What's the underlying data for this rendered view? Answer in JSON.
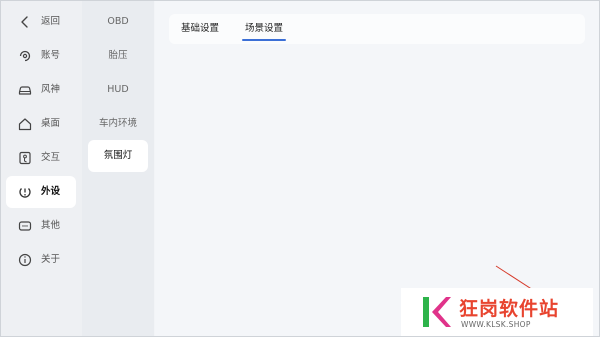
{
  "sidebar": {
    "items": [
      {
        "label": "返回",
        "icon": "back-chevron-icon"
      },
      {
        "label": "账号",
        "icon": "account-icon"
      },
      {
        "label": "风神",
        "icon": "car-icon"
      },
      {
        "label": "桌面",
        "icon": "home-icon"
      },
      {
        "label": "交互",
        "icon": "interaction-icon"
      },
      {
        "label": "外设",
        "icon": "peripheral-icon",
        "active": true
      },
      {
        "label": "其他",
        "icon": "more-icon"
      },
      {
        "label": "关于",
        "icon": "info-icon"
      }
    ]
  },
  "subnav": {
    "items": [
      {
        "label": "OBD"
      },
      {
        "label": "胎压"
      },
      {
        "label": "HUD"
      },
      {
        "label": "车内环境"
      },
      {
        "label": "氛围灯",
        "active": true
      }
    ]
  },
  "tabs": [
    {
      "label": "基础设置"
    },
    {
      "label": "场景设置",
      "active": true
    }
  ],
  "watermark": {
    "title": "狂岗软件站",
    "url": "WWW.KLSK.SHOP"
  },
  "colors": {
    "accent": "#3b6fd6",
    "watermark_red": "#e8442f",
    "logo_green": "#2db34a",
    "logo_pink": "#e0338a"
  }
}
